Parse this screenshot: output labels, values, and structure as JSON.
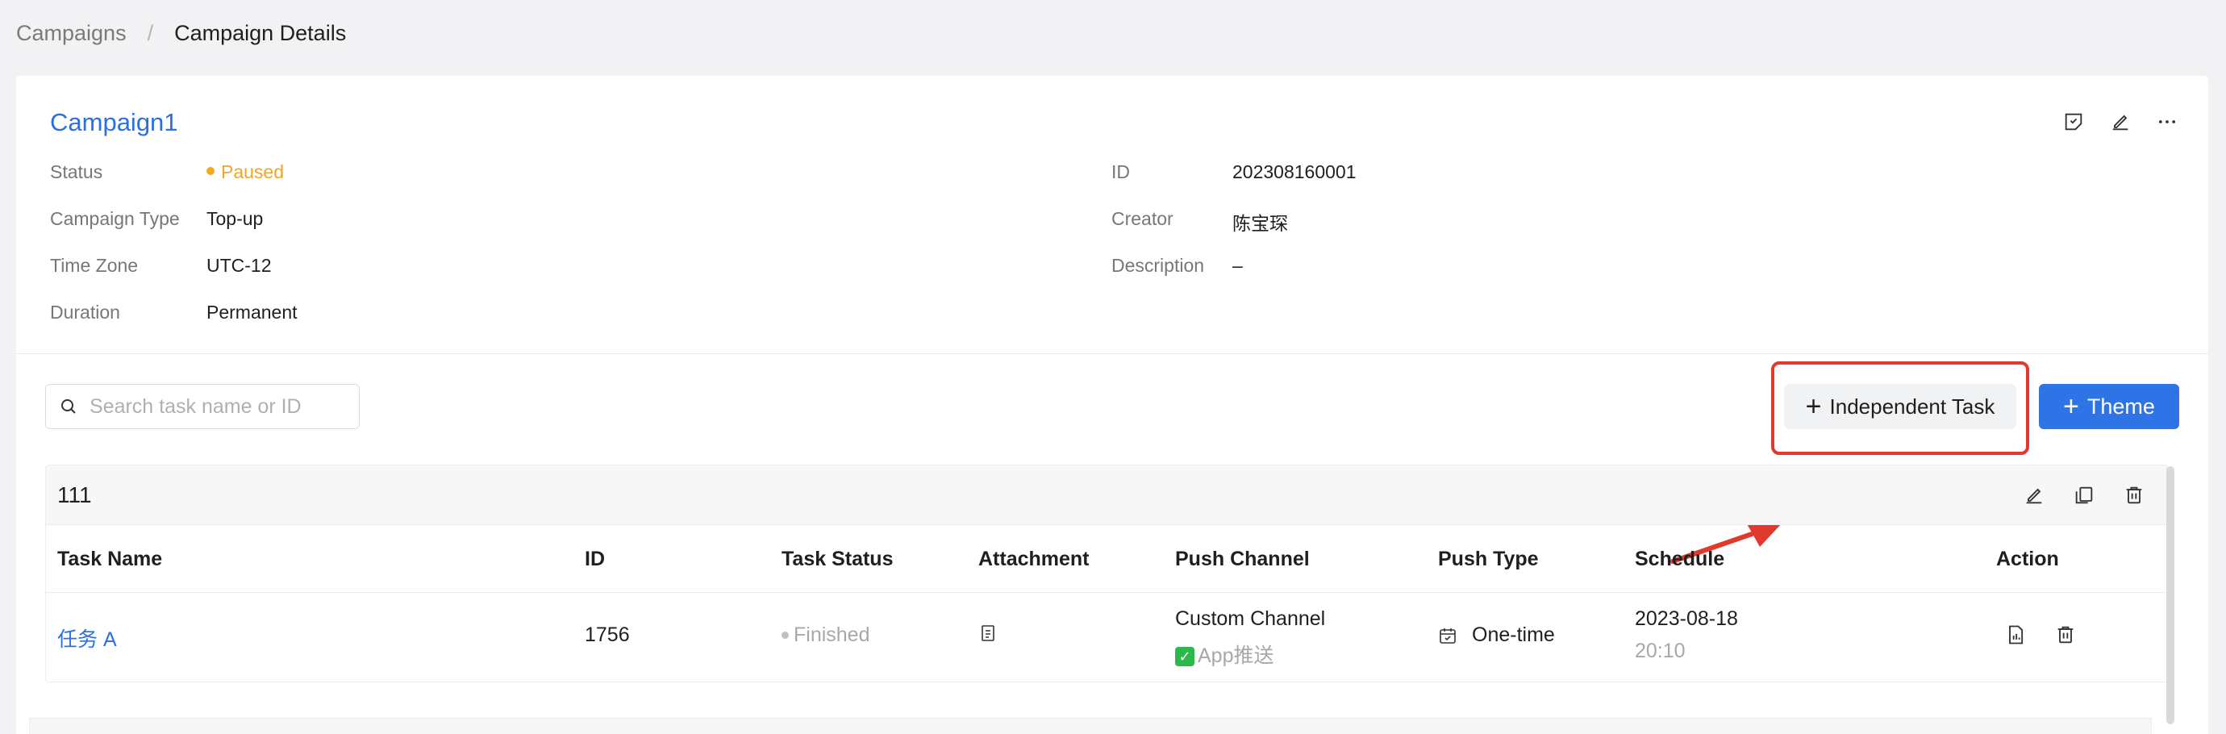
{
  "breadcrumb": {
    "parent": "Campaigns",
    "separator": "/",
    "current": "Campaign Details"
  },
  "campaign": {
    "title": "Campaign1",
    "fields_left": [
      {
        "label": "Status",
        "value": "Paused"
      },
      {
        "label": "Campaign Type",
        "value": "Top-up"
      },
      {
        "label": "Time Zone",
        "value": "UTC-12"
      },
      {
        "label": "Duration",
        "value": "Permanent"
      }
    ],
    "fields_right": [
      {
        "label": "ID",
        "value": "202308160001"
      },
      {
        "label": "Creator",
        "value": "陈宝琛"
      },
      {
        "label": "Description",
        "value": "–"
      }
    ]
  },
  "toolbar": {
    "search_placeholder": "Search task name or ID",
    "independent_task_label": "Independent Task",
    "theme_label": "Theme"
  },
  "group": {
    "title": "111",
    "columns": [
      "Task Name",
      "ID",
      "Task Status",
      "Attachment",
      "Push Channel",
      "Push Type",
      "Schedule",
      "Action"
    ],
    "rows": [
      {
        "task_name": "任务 A",
        "id": "1756",
        "status": "Finished",
        "push_channel": "Custom Channel",
        "push_channel_sub": "App推送",
        "push_type": "One-time",
        "schedule_date": "2023-08-18",
        "schedule_time": "20:10"
      }
    ]
  },
  "colors": {
    "accent": "#2f74e6",
    "link": "#2b6fe0",
    "paused": "#f0a528",
    "highlight": "#e03a2e"
  }
}
